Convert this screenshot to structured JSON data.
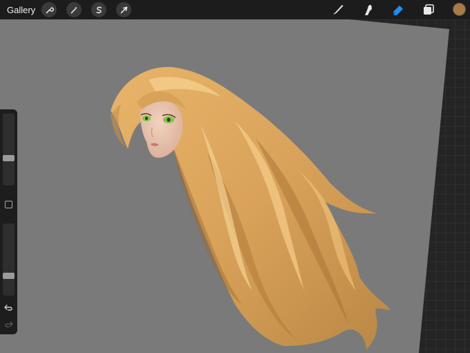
{
  "topbar": {
    "gallery_label": "Gallery",
    "left_tools": [
      {
        "name": "actions-wrench",
        "icon": "wrench-icon"
      },
      {
        "name": "adjustments",
        "icon": "magic-wand-icon"
      },
      {
        "name": "selection",
        "icon": "selection-s-icon"
      },
      {
        "name": "transform",
        "icon": "arrow-cursor-icon"
      }
    ],
    "right_tools": [
      {
        "name": "brush",
        "icon": "brush-icon",
        "active": false
      },
      {
        "name": "smudge",
        "icon": "smudge-finger-icon",
        "active": false
      },
      {
        "name": "eraser",
        "icon": "eraser-icon",
        "active": true
      },
      {
        "name": "layers",
        "icon": "layers-icon",
        "active": false
      }
    ],
    "current_color": "#a87a45"
  },
  "sidebar": {
    "brush_size_level": 0.63,
    "opacity_level": 0.75,
    "undo_icon": "undo-icon",
    "redo_icon": "redo-icon"
  },
  "colors": {
    "canvas": "#7a7a7a",
    "hair_dark": "#b8843f",
    "hair_mid": "#d9a460",
    "hair_light": "#f3c985",
    "skin": "#e9c7b2",
    "eyes": "#7fc64a",
    "accent_blue": "#1f8ef1"
  }
}
